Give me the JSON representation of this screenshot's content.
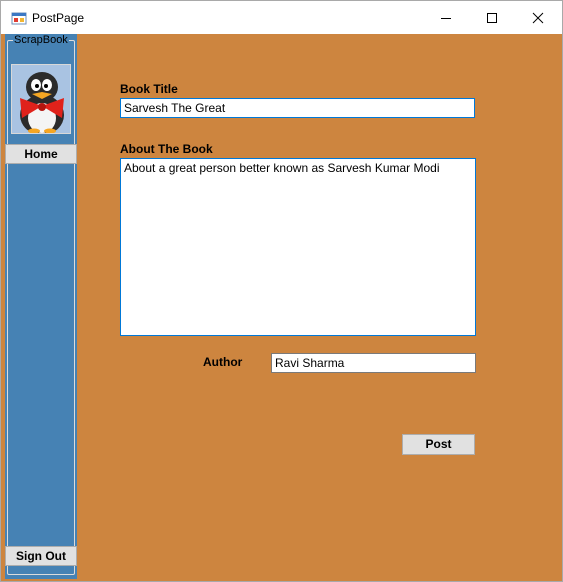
{
  "window": {
    "title": "PostPage",
    "app_icon": "form-app-icon",
    "controls": {
      "minimize": "minimize-icon",
      "maximize": "maximize-icon",
      "close": "close-icon"
    }
  },
  "colors": {
    "client_background": "#cd853f",
    "sidebar_background": "#4682b4",
    "button_face": "#e1e1e1"
  },
  "sidebar": {
    "group_title": "ScrapBook",
    "avatar": "penguin-with-bowtie-avatar",
    "home_label": "Home",
    "signout_label": "Sign Out"
  },
  "form": {
    "book_title_label": "Book Title",
    "book_title_value": "Sarvesh The Great",
    "about_label": "About The Book",
    "about_value": "About a great person better known as Sarvesh Kumar Modi",
    "author_label": "Author",
    "author_value": "Ravi Sharma",
    "post_label": "Post"
  }
}
